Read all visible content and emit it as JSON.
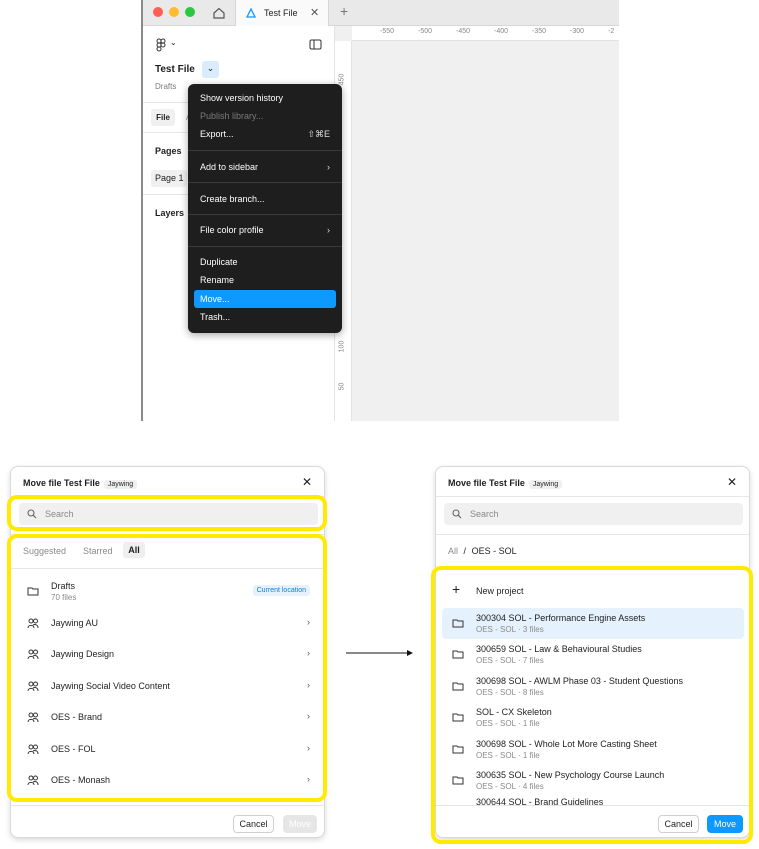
{
  "figma": {
    "tab_title": "Test File",
    "file_name": "Test File",
    "file_location": "Drafts",
    "sidebar_tab_file": "File",
    "sidebar_tab_truncated": "A",
    "pages_label": "Pages",
    "page_1": "Page 1",
    "layers_label": "Layers",
    "ruler_top": [
      "-550",
      "-500",
      "-450",
      "-400",
      "-350",
      "-300",
      "-2"
    ],
    "ruler_left": [
      "450",
      "100",
      "50"
    ],
    "menu": {
      "show_version_history": "Show version history",
      "publish_library": "Publish library...",
      "export": "Export...",
      "export_shortcut": "⇧⌘E",
      "add_to_sidebar": "Add to sidebar",
      "create_branch": "Create branch...",
      "file_color_profile": "File color profile",
      "duplicate": "Duplicate",
      "rename": "Rename",
      "move": "Move...",
      "trash": "Trash..."
    }
  },
  "dialog_left": {
    "title": "Move file Test File",
    "badge": "Jaywing",
    "search_placeholder": "Search",
    "tabs": [
      "Suggested",
      "Starred",
      "All"
    ],
    "drafts": {
      "name": "Drafts",
      "count": "70 files",
      "badge": "Current location"
    },
    "teams": [
      "Jaywing AU",
      "Jaywing Design",
      "Jaywing Social Video Content",
      "OES - Brand",
      "OES - FOL",
      "OES - Monash"
    ],
    "cancel": "Cancel",
    "move": "Move"
  },
  "dialog_right": {
    "title": "Move file Test File",
    "badge": "Jaywing",
    "search_placeholder": "Search",
    "breadcrumb_root": "All",
    "breadcrumb_sep": "/",
    "breadcrumb_current": "OES - SOL",
    "new_project": "New project",
    "projects": [
      {
        "name": "300304 SOL - Performance Engine Assets",
        "meta": "OES - SOL · 3 files"
      },
      {
        "name": "300659 SOL - Law & Behavioural Studies",
        "meta": "OES - SOL · 7 files"
      },
      {
        "name": "300698 SOL - AWLM Phase 03 - Student Questions",
        "meta": "OES - SOL · 8 files"
      },
      {
        "name": "SOL - CX Skeleton",
        "meta": "OES - SOL · 1 file"
      },
      {
        "name": "300698 SOL - Whole Lot More Casting Sheet",
        "meta": "OES - SOL · 1 file"
      },
      {
        "name": "300635 SOL - New Psychology Course Launch",
        "meta": "OES - SOL · 4 files"
      },
      {
        "name": "300644 SOL - Brand Guidelines",
        "meta": ""
      }
    ],
    "cancel": "Cancel",
    "move": "Move"
  },
  "colors": {
    "accent": "#0d99ff",
    "highlight": "#ffea00",
    "selected_row": "#e5f2fd",
    "menu_bg": "#1e1e1e"
  }
}
